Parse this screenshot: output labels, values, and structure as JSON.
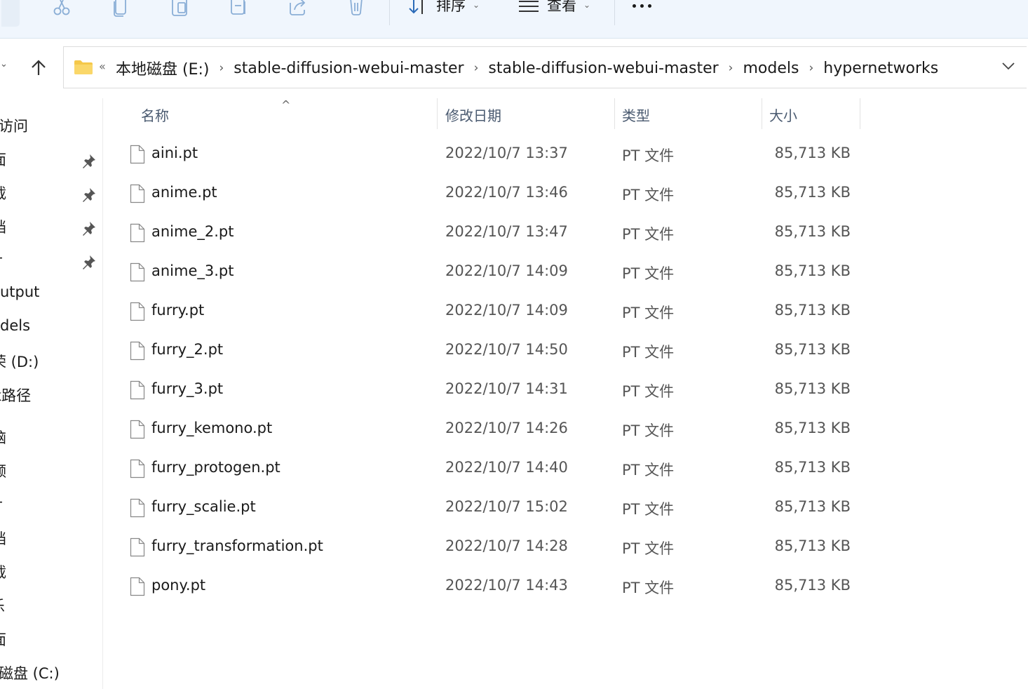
{
  "toolbar": {
    "sort_label": "排序",
    "view_label": "查看",
    "icons": [
      "cut-icon",
      "copy-icon",
      "paste-icon",
      "rename-icon",
      "share-icon",
      "delete-icon",
      "sort-icon",
      "view-icon",
      "more-icon"
    ]
  },
  "address": {
    "overflow": "«",
    "crumbs": [
      "本地磁盘 (E:)",
      "stable-diffusion-webui-master",
      "stable-diffusion-webui-master",
      "models",
      "hypernetworks"
    ]
  },
  "sidebar": {
    "items": [
      {
        "label": "访问",
        "pinned": false
      },
      {
        "label": "面",
        "pinned": true
      },
      {
        "label": "载",
        "pinned": true
      },
      {
        "label": "档",
        "pinned": true
      },
      {
        "label": "片",
        "pinned": true
      },
      {
        "label": "utput",
        "pinned": false
      },
      {
        "label": "dels",
        "pinned": false
      },
      {
        "label": "荣 (D:)",
        "pinned": false
      },
      {
        "label": "k路径",
        "pinned": false
      },
      {
        "label": "脑",
        "pinned": false
      },
      {
        "label": "频",
        "pinned": false
      },
      {
        "label": "片",
        "pinned": false
      },
      {
        "label": "档",
        "pinned": false
      },
      {
        "label": "载",
        "pinned": false
      },
      {
        "label": "乐",
        "pinned": false
      },
      {
        "label": "面",
        "pinned": false
      },
      {
        "label": "磁盘 (C:)",
        "pinned": false
      }
    ]
  },
  "list": {
    "columns": {
      "name": "名称",
      "date": "修改日期",
      "type": "类型",
      "size": "大小"
    },
    "sort_indicator": "^",
    "files": [
      {
        "name": "aini.pt",
        "date": "2022/10/7 13:37",
        "type": "PT 文件",
        "size": "85,713 KB"
      },
      {
        "name": "anime.pt",
        "date": "2022/10/7 13:46",
        "type": "PT 文件",
        "size": "85,713 KB"
      },
      {
        "name": "anime_2.pt",
        "date": "2022/10/7 13:47",
        "type": "PT 文件",
        "size": "85,713 KB"
      },
      {
        "name": "anime_3.pt",
        "date": "2022/10/7 14:09",
        "type": "PT 文件",
        "size": "85,713 KB"
      },
      {
        "name": "furry.pt",
        "date": "2022/10/7 14:09",
        "type": "PT 文件",
        "size": "85,713 KB"
      },
      {
        "name": "furry_2.pt",
        "date": "2022/10/7 14:50",
        "type": "PT 文件",
        "size": "85,713 KB"
      },
      {
        "name": "furry_3.pt",
        "date": "2022/10/7 14:31",
        "type": "PT 文件",
        "size": "85,713 KB"
      },
      {
        "name": "furry_kemono.pt",
        "date": "2022/10/7 14:26",
        "type": "PT 文件",
        "size": "85,713 KB"
      },
      {
        "name": "furry_protogen.pt",
        "date": "2022/10/7 14:40",
        "type": "PT 文件",
        "size": "85,713 KB"
      },
      {
        "name": "furry_scalie.pt",
        "date": "2022/10/7 15:02",
        "type": "PT 文件",
        "size": "85,713 KB"
      },
      {
        "name": "furry_transformation.pt",
        "date": "2022/10/7 14:28",
        "type": "PT 文件",
        "size": "85,713 KB"
      },
      {
        "name": "pony.pt",
        "date": "2022/10/7 14:43",
        "type": "PT 文件",
        "size": "85,713 KB"
      }
    ]
  }
}
